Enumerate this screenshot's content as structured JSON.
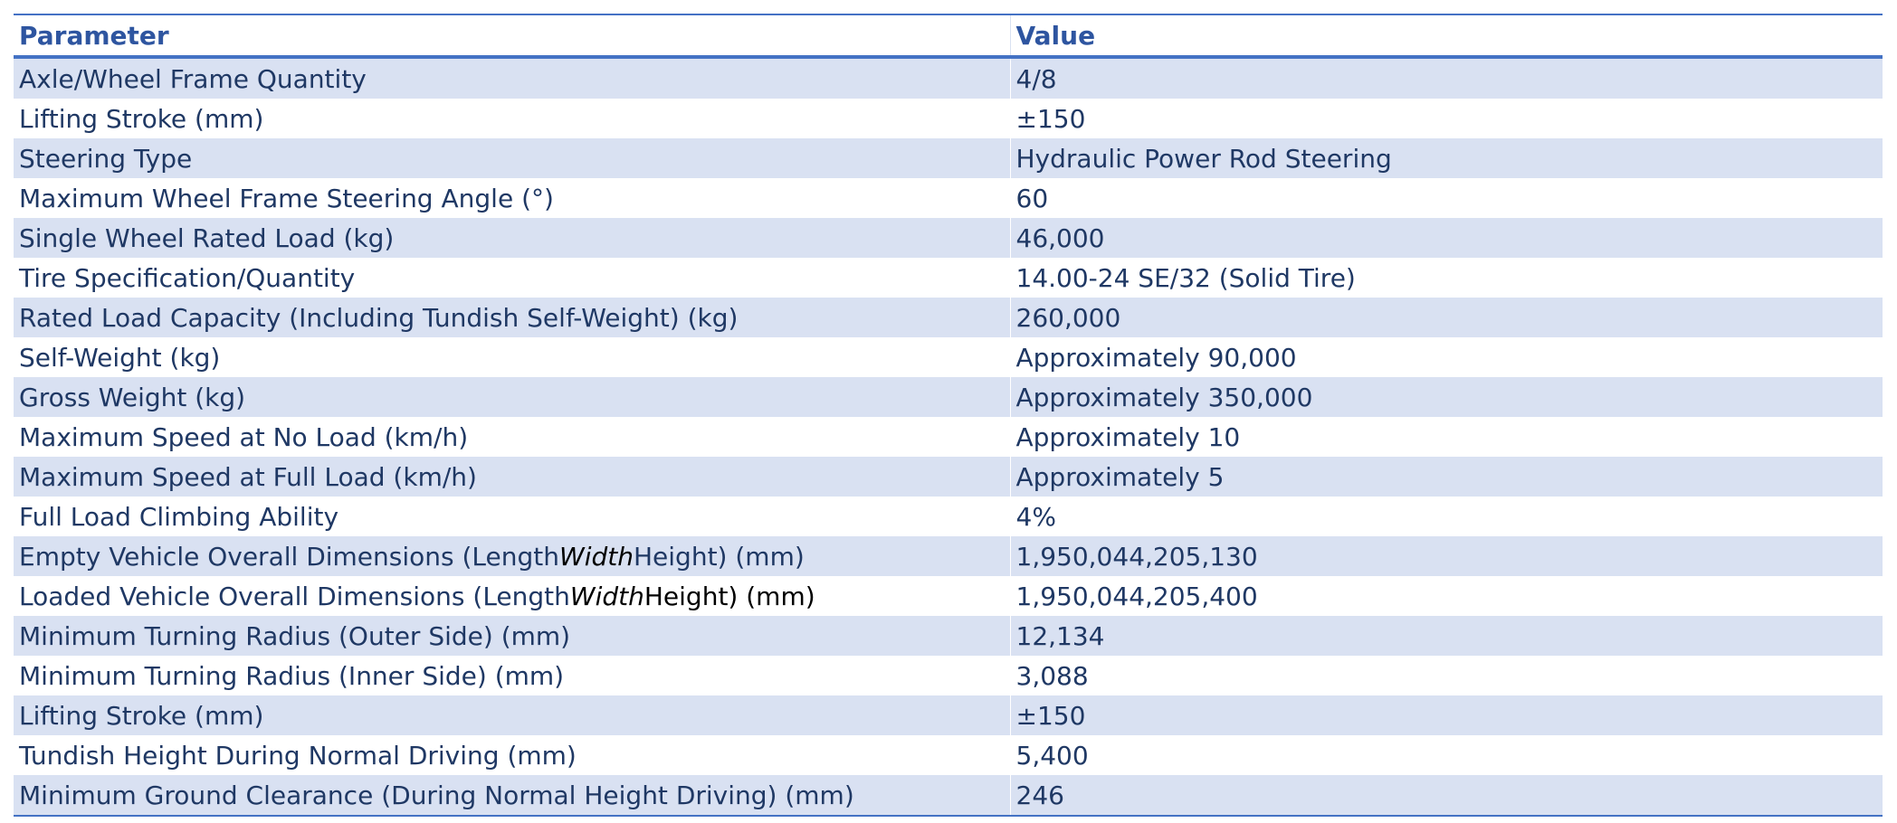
{
  "table": {
    "headers": [
      "Parameter",
      "Value"
    ],
    "rows": [
      {
        "parameter": "Axle/Wheel Frame Quantity",
        "value": "4/8"
      },
      {
        "parameter": "Lifting Stroke (mm)",
        "value": "±150"
      },
      {
        "parameter": "Steering Type",
        "value": "Hydraulic Power Rod Steering"
      },
      {
        "parameter": "Maximum Wheel Frame Steering Angle (°)",
        "value": "60"
      },
      {
        "parameter": "Single Wheel Rated Load (kg)",
        "value": "46,000"
      },
      {
        "parameter": "Tire Specification/Quantity",
        "value": "14.00-24 SE/32 (Solid Tire)"
      },
      {
        "parameter": "Rated Load Capacity (Including Tundish Self-Weight) (kg)",
        "value": "260,000"
      },
      {
        "parameter": "Self-Weight (kg)",
        "value": "Approximately 90,000"
      },
      {
        "parameter": "Gross Weight (kg)",
        "value": "Approximately 350,000"
      },
      {
        "parameter": "Maximum Speed at No Load (km/h)",
        "value": "Approximately 10"
      },
      {
        "parameter": "Maximum Speed at Full Load (km/h)",
        "value": "Approximately 5"
      },
      {
        "parameter": "Full Load Climbing Ability",
        "value": "4%"
      },
      {
        "parameter_parts": [
          "Empty Vehicle Overall Dimensions (Length",
          "Width",
          "Height) (mm)"
        ],
        "value": "1,950,044,205,130"
      },
      {
        "parameter_parts": [
          "Loaded Vehicle Overall Dimensions (Length",
          "Width",
          "Height) (mm)"
        ],
        "value": "1,950,044,205,400"
      },
      {
        "parameter": "Minimum Turning Radius (Outer Side) (mm)",
        "value": "12,134"
      },
      {
        "parameter": "Minimum Turning Radius (Inner Side) (mm)",
        "value": "3,088"
      },
      {
        "parameter": "Lifting Stroke (mm)",
        "value": "±150"
      },
      {
        "parameter": "Tundish Height During Normal Driving (mm)",
        "value": "5,400"
      },
      {
        "parameter": "Minimum Ground Clearance (During Normal Height Driving) (mm)",
        "value": "246"
      }
    ]
  }
}
